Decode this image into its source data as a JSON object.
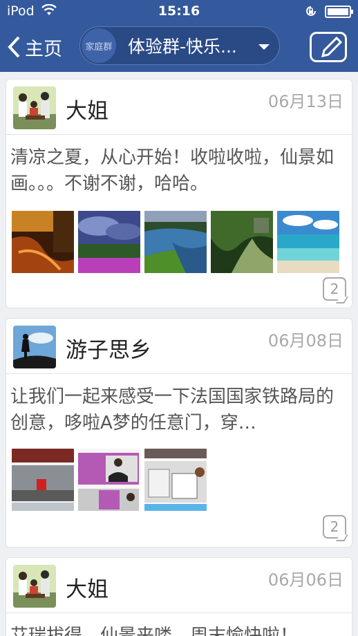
{
  "status": {
    "carrier": "iPod",
    "time": "15:16"
  },
  "nav": {
    "back_label": "主页",
    "group_tag": "家庭群",
    "group_name": "体验群-快乐..."
  },
  "posts": [
    {
      "author": "大姐",
      "date": "06月13日",
      "text": "清凉之夏，从心开始！收啦收啦，仙景如画。。。不谢不谢，哈哈。",
      "comments": "2"
    },
    {
      "author": "游子思乡",
      "date": "06月08日",
      "text": "让我们一起来感受一下法国国家铁路局的创意，哆啦A梦的任意门，穿…",
      "comments": "2"
    },
    {
      "author": "大姐",
      "date": "06月06日",
      "text": "艾瑞拔得，仙景来喽，周末愉快啦！"
    }
  ]
}
